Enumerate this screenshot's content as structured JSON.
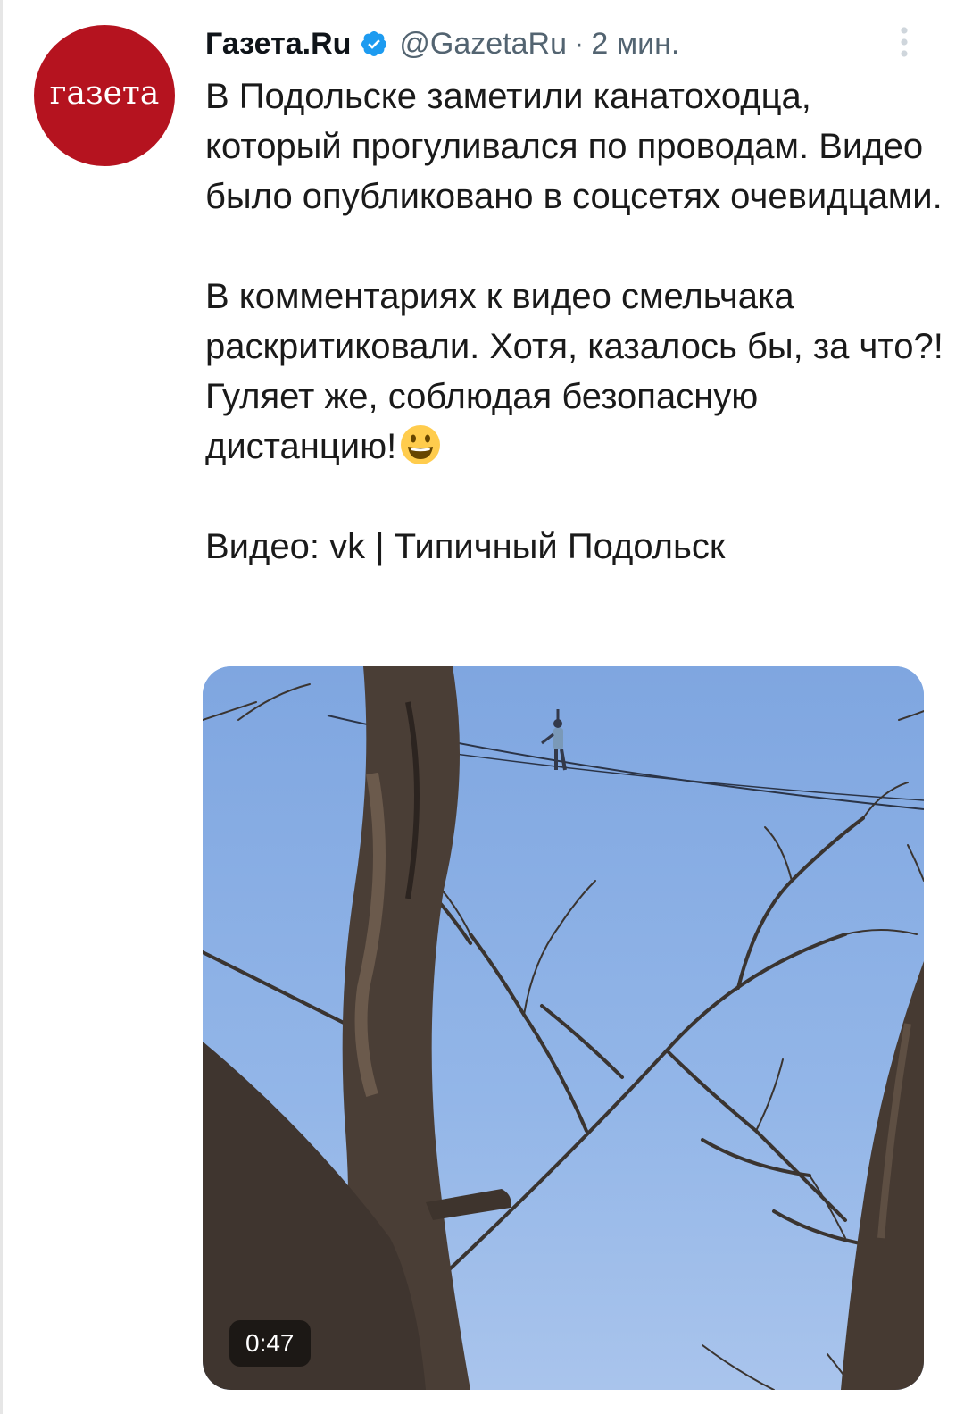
{
  "tweet": {
    "avatar_text": "газета",
    "display_name": "Газета.Ru",
    "handle": "@GazetaRu",
    "separator": "·",
    "time": "2 мин.",
    "paragraphs": [
      "В Подольске заметили канатоходца, который прогуливался по проводам. Видео было опубликовано в соцсетях очевидцами.",
      "В комментариях к видео смельчака раскритиковали. Хотя, казалось бы, за что?! Гуляет же, соблюдая безопасную дистанцию!",
      "Видео: vk | Типичный Подольск"
    ],
    "emoji": "grinning-face-emoji",
    "media": {
      "type": "video",
      "duration": "0:47"
    }
  },
  "colors": {
    "brand": "#b5131f",
    "verified": "#1d9bf0",
    "secondary_text": "#536471",
    "sky": "#8fb3e6"
  },
  "icons": {
    "verified": "verified-badge-icon",
    "more": "more-vertical-icon"
  }
}
